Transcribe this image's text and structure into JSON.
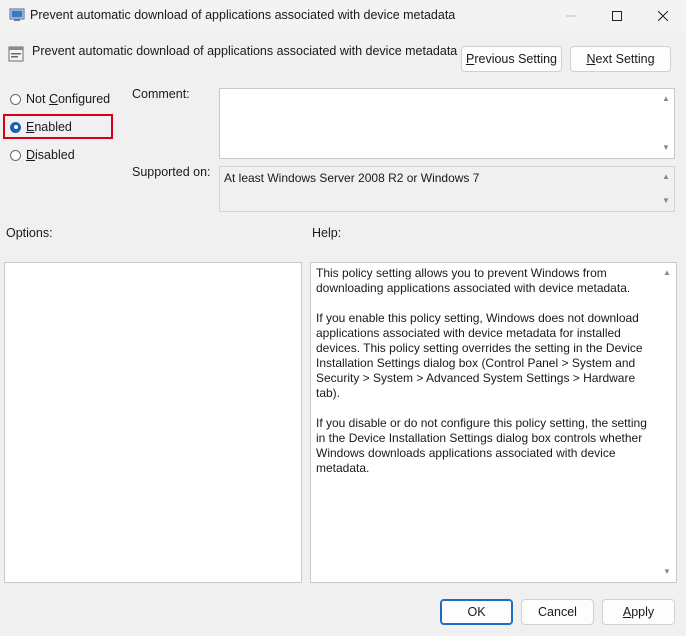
{
  "window": {
    "title": "Prevent automatic download of applications associated with device metadata",
    "icons": [
      "policy-window-icon",
      "minimize-icon",
      "maximize-icon",
      "close-icon"
    ]
  },
  "header": {
    "policy_name": "Prevent automatic download of applications associated with device metadata",
    "previous_setting_prefix": "P",
    "previous_setting_rest": "revious Setting",
    "next_setting_prefix": "N",
    "next_setting_rest": "ext Setting"
  },
  "state": {
    "options": [
      {
        "accel": "C",
        "before": "Not ",
        "after": "onfigured",
        "checked": false
      },
      {
        "accel": "E",
        "before": "",
        "after": "nabled",
        "checked": true
      },
      {
        "accel": "D",
        "before": "",
        "after": "isabled",
        "checked": false
      }
    ],
    "highlight_color": "#d7001a"
  },
  "comment": {
    "label": "Comment:",
    "value": ""
  },
  "supported_on": {
    "label": "Supported on:",
    "value": "At least Windows Server 2008 R2 or Windows 7"
  },
  "options_panel": {
    "label": "Options:"
  },
  "help_panel": {
    "label": "Help:",
    "paragraphs": [
      "This policy setting allows you to prevent Windows from downloading applications associated with device metadata.",
      "If you enable this policy setting, Windows does not download applications associated with device metadata for installed devices. This policy setting overrides the setting in the Device Installation Settings dialog box (Control Panel > System and Security > System > Advanced System Settings > Hardware tab).",
      "If you disable or do not configure this policy setting, the setting in the Device Installation Settings dialog box controls whether Windows downloads applications associated with device metadata."
    ]
  },
  "footer": {
    "ok": "OK",
    "cancel": "Cancel",
    "apply_prefix": "A",
    "apply_rest": "pply"
  },
  "colors": {
    "accent": "#1a5fb4",
    "background": "#f0f0f0"
  }
}
